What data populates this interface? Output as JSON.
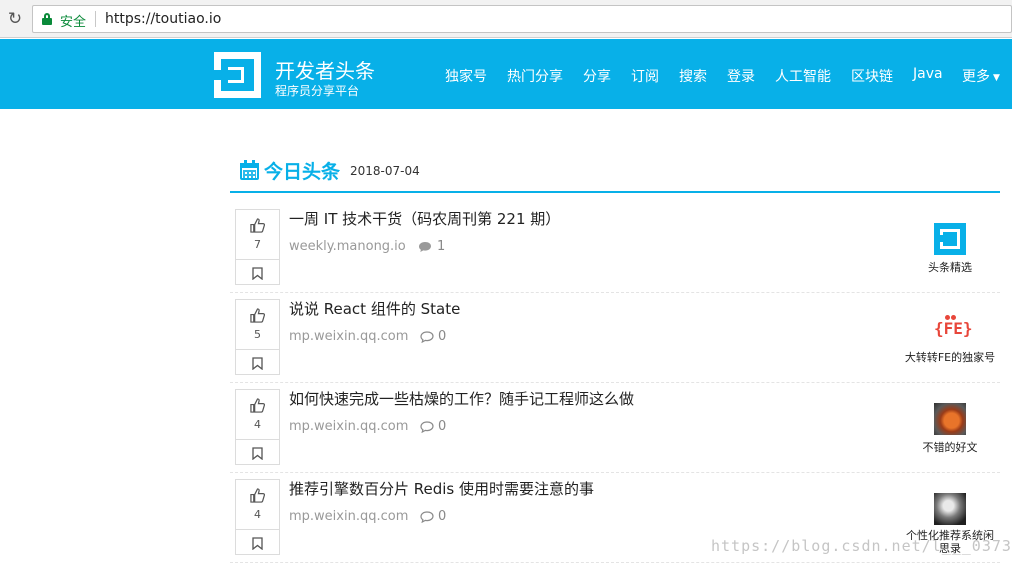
{
  "browser": {
    "secure_label": "安全",
    "url": "https://toutiao.io"
  },
  "header": {
    "title": "开发者头条",
    "subtitle": "程序员分享平台",
    "nav": [
      "独家号",
      "热门分享",
      "分享",
      "订阅",
      "搜索",
      "登录",
      "人工智能",
      "区块链",
      "Java",
      "更多"
    ]
  },
  "section": {
    "title": "今日头条",
    "date": "2018-07-04"
  },
  "articles": [
    {
      "votes": "7",
      "title": "一周 IT 技术干货（码农周刊第 221 期）",
      "source": "weekly.manong.io",
      "comments": "1",
      "author": "头条精选",
      "author_icon": "toutiao-logo-avatar"
    },
    {
      "votes": "5",
      "title": "说说 React 组件的 State",
      "source": "mp.weixin.qq.com",
      "comments": "0",
      "author": "大转转FE的独家号",
      "author_icon": "fe-logo-avatar"
    },
    {
      "votes": "4",
      "title": "如何快速完成一些枯燥的工作？随手记工程师这么做",
      "source": "mp.weixin.qq.com",
      "comments": "0",
      "author": "不错的好文",
      "author_icon": "photo-avatar"
    },
    {
      "votes": "4",
      "title": "推荐引擎数百分片 Redis 使用时需要注意的事",
      "source": "mp.weixin.qq.com",
      "comments": "0",
      "author_line1": "个性化推荐系统闲",
      "author_line2": "思录",
      "author_icon": "photo-avatar"
    }
  ],
  "watermark": "https://blog.csdn.net/l___0373",
  "colors": {
    "brand": "#08b0e8",
    "secure": "#0a8a3a"
  }
}
